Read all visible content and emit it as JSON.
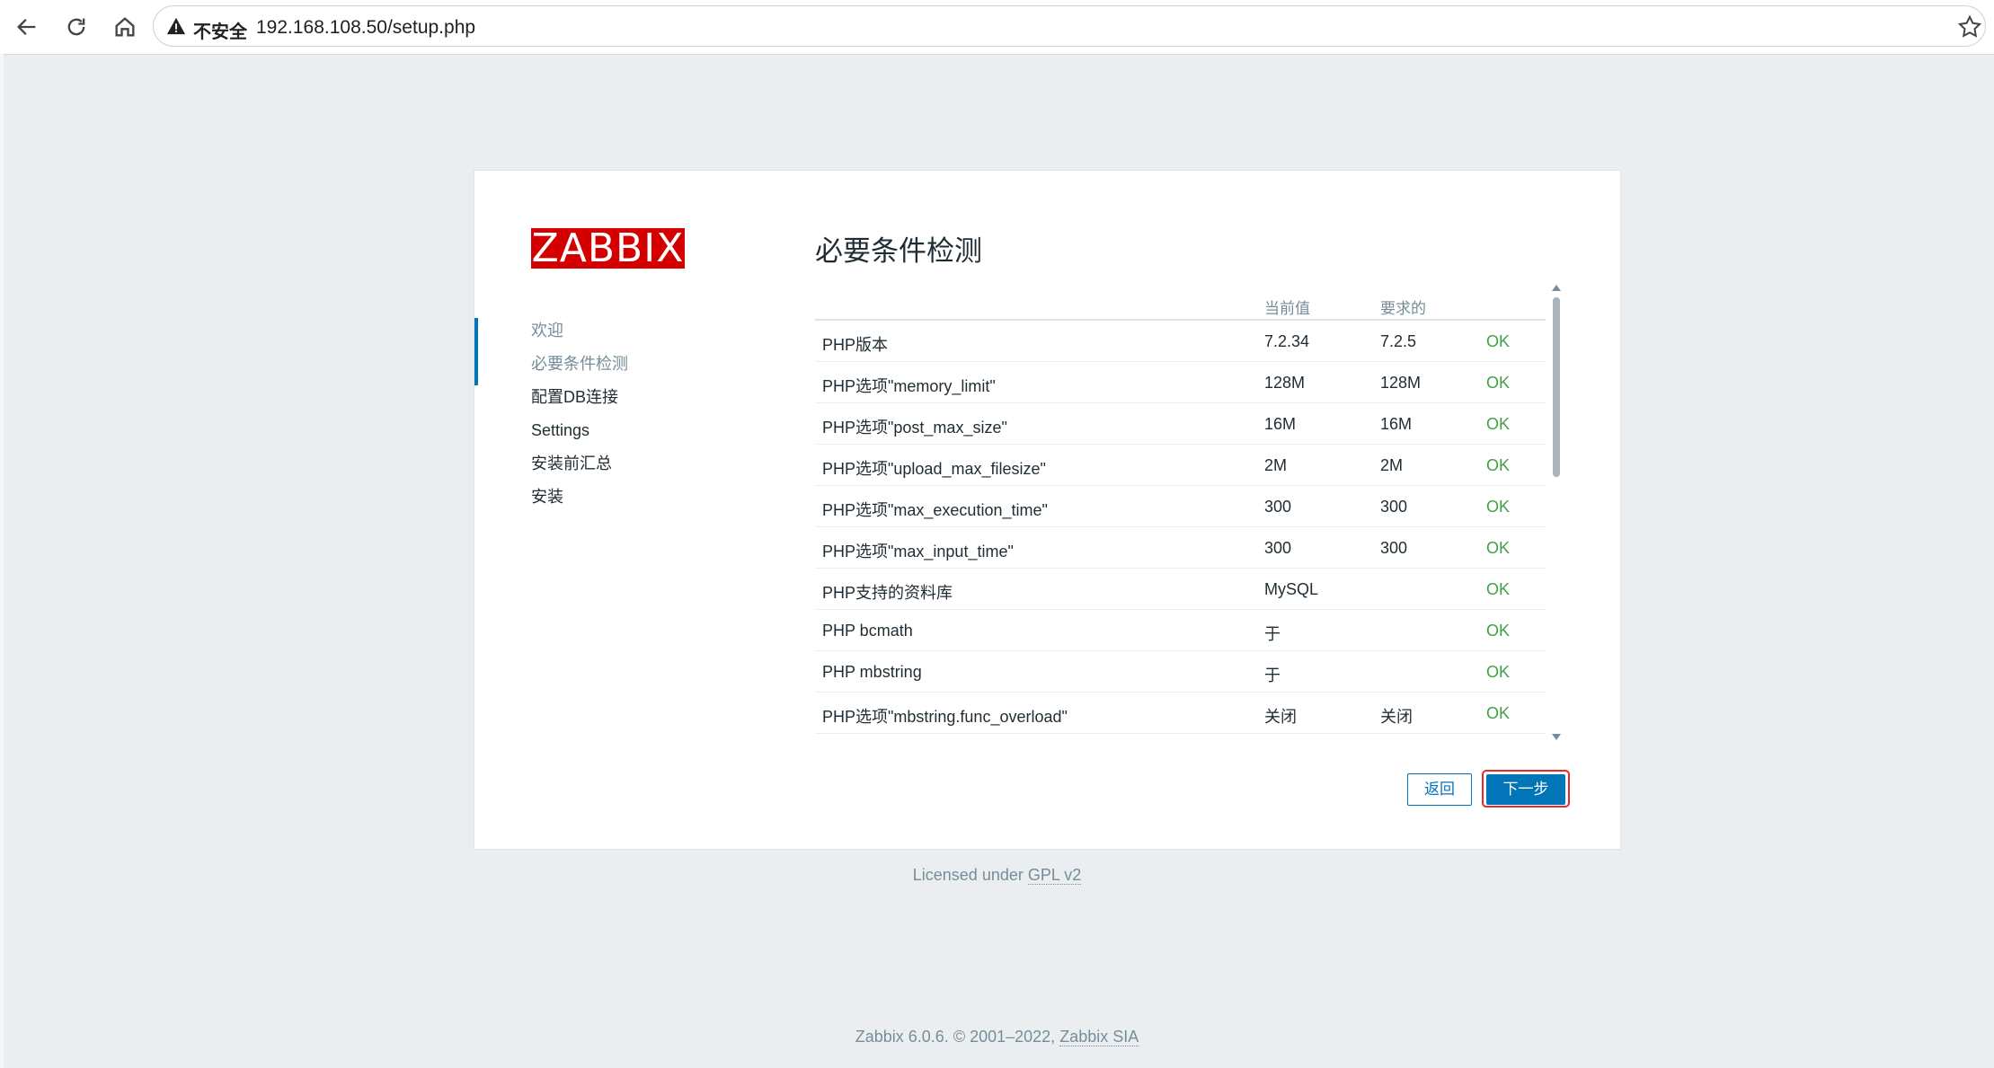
{
  "browser": {
    "security_label": "不安全",
    "url": "192.168.108.50/setup.php",
    "icons": [
      "back-arrow-icon",
      "reload-icon",
      "home-icon",
      "warning-icon",
      "star-icon"
    ]
  },
  "logo_text": "ZABBIX",
  "steps": [
    {
      "label": "欢迎",
      "state": "done"
    },
    {
      "label": "必要条件检测",
      "state": "current"
    },
    {
      "label": "配置DB连接",
      "state": "pending"
    },
    {
      "label": "Settings",
      "state": "pending"
    },
    {
      "label": "安装前汇总",
      "state": "pending"
    },
    {
      "label": "安装",
      "state": "pending"
    }
  ],
  "page_title": "必要条件检测",
  "table": {
    "headers": {
      "name": "",
      "current": "当前值",
      "required": "要求的",
      "result": ""
    },
    "rows": [
      {
        "name": "PHP版本",
        "current": "7.2.34",
        "required": "7.2.5",
        "result": "OK"
      },
      {
        "name": "PHP选项\"memory_limit\"",
        "current": "128M",
        "required": "128M",
        "result": "OK"
      },
      {
        "name": "PHP选项\"post_max_size\"",
        "current": "16M",
        "required": "16M",
        "result": "OK"
      },
      {
        "name": "PHP选项\"upload_max_filesize\"",
        "current": "2M",
        "required": "2M",
        "result": "OK"
      },
      {
        "name": "PHP选项\"max_execution_time\"",
        "current": "300",
        "required": "300",
        "result": "OK"
      },
      {
        "name": "PHP选项\"max_input_time\"",
        "current": "300",
        "required": "300",
        "result": "OK"
      },
      {
        "name": "PHP支持的资料库",
        "current": "MySQL",
        "required": "",
        "result": "OK"
      },
      {
        "name": "PHP bcmath",
        "current": "于",
        "required": "",
        "result": "OK"
      },
      {
        "name": "PHP mbstring",
        "current": "于",
        "required": "",
        "result": "OK"
      },
      {
        "name": "PHP选项\"mbstring.func_overload\"",
        "current": "关闭",
        "required": "关闭",
        "result": "OK"
      }
    ]
  },
  "buttons": {
    "back": "返回",
    "next": "下一步"
  },
  "license": {
    "prefix": "Licensed under ",
    "link": "GPL v2"
  },
  "footer": {
    "text": "Zabbix 6.0.6. © 2001–2022, ",
    "link": "Zabbix SIA"
  },
  "colors": {
    "brand": "#d40000",
    "accent": "#0275b8",
    "ok": "#429e47",
    "muted": "#768d99",
    "highlight": "#e8282a"
  }
}
